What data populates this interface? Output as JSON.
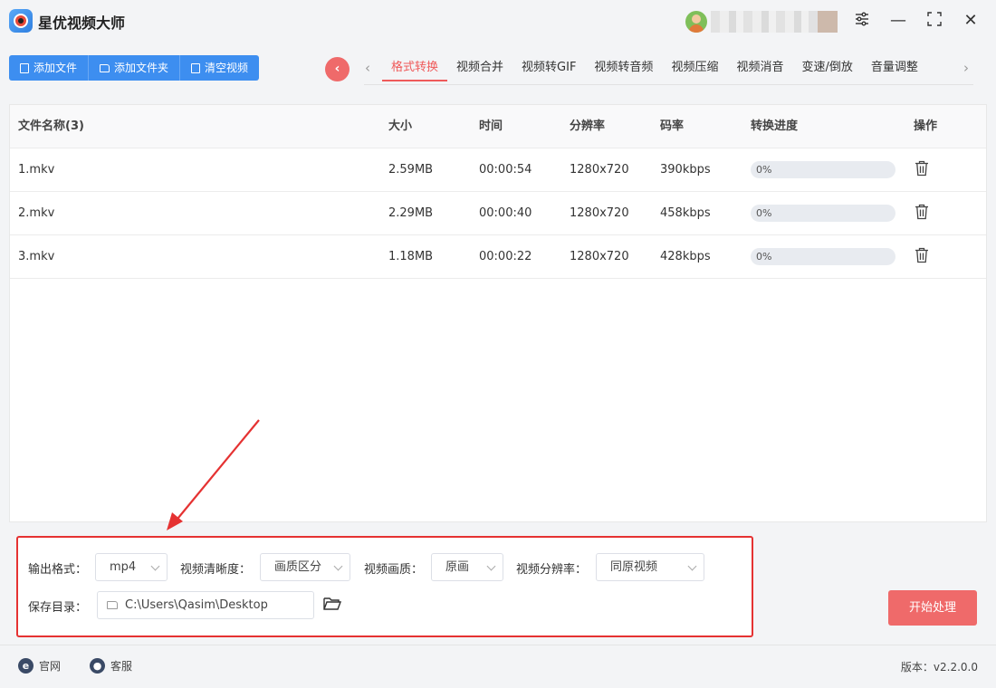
{
  "app": {
    "title": "星优视频大师"
  },
  "window": {
    "settings_icon": "sliders-icon",
    "minimize": "—",
    "maximize": "⛶",
    "close": "✕"
  },
  "toolbar": {
    "add_file": "添加文件",
    "add_folder": "添加文件夹",
    "clear_videos": "清空视频"
  },
  "tabs": [
    "格式转换",
    "视频合并",
    "视频转GIF",
    "视频转音频",
    "视频压缩",
    "视频消音",
    "变速/倒放",
    "音量调整"
  ],
  "active_tab": 0,
  "table": {
    "headers": {
      "name": "文件名称(3)",
      "size": "大小",
      "time": "时间",
      "resolution": "分辨率",
      "bitrate": "码率",
      "progress": "转换进度",
      "action": "操作"
    },
    "rows": [
      {
        "name": "1.mkv",
        "size": "2.59MB",
        "time": "00:00:54",
        "resolution": "1280x720",
        "bitrate": "390kbps",
        "progress": "0%",
        "progress_value": 0
      },
      {
        "name": "2.mkv",
        "size": "2.29MB",
        "time": "00:00:40",
        "resolution": "1280x720",
        "bitrate": "458kbps",
        "progress": "0%",
        "progress_value": 0
      },
      {
        "name": "3.mkv",
        "size": "1.18MB",
        "time": "00:00:22",
        "resolution": "1280x720",
        "bitrate": "428kbps",
        "progress": "0%",
        "progress_value": 0
      }
    ]
  },
  "settings": {
    "output_format_label": "输出格式：",
    "output_format_value": "mp4",
    "clarity_label": "视频清晰度：",
    "clarity_value": "画质区分",
    "quality_label": "视频画质：",
    "quality_value": "原画",
    "resolution_label": "视频分辨率：",
    "resolution_value": "同原视频",
    "save_dir_label": "保存目录：",
    "save_dir_value": "C:\\Users\\Qasim\\Desktop"
  },
  "start_button": "开始处理",
  "footer": {
    "website": "官网",
    "support": "客服",
    "version": "版本：v2.2.0.0"
  },
  "colors": {
    "accent_blue": "#3d8ef0",
    "accent_red": "#ef6a6a",
    "highlight_red": "#e53232"
  }
}
